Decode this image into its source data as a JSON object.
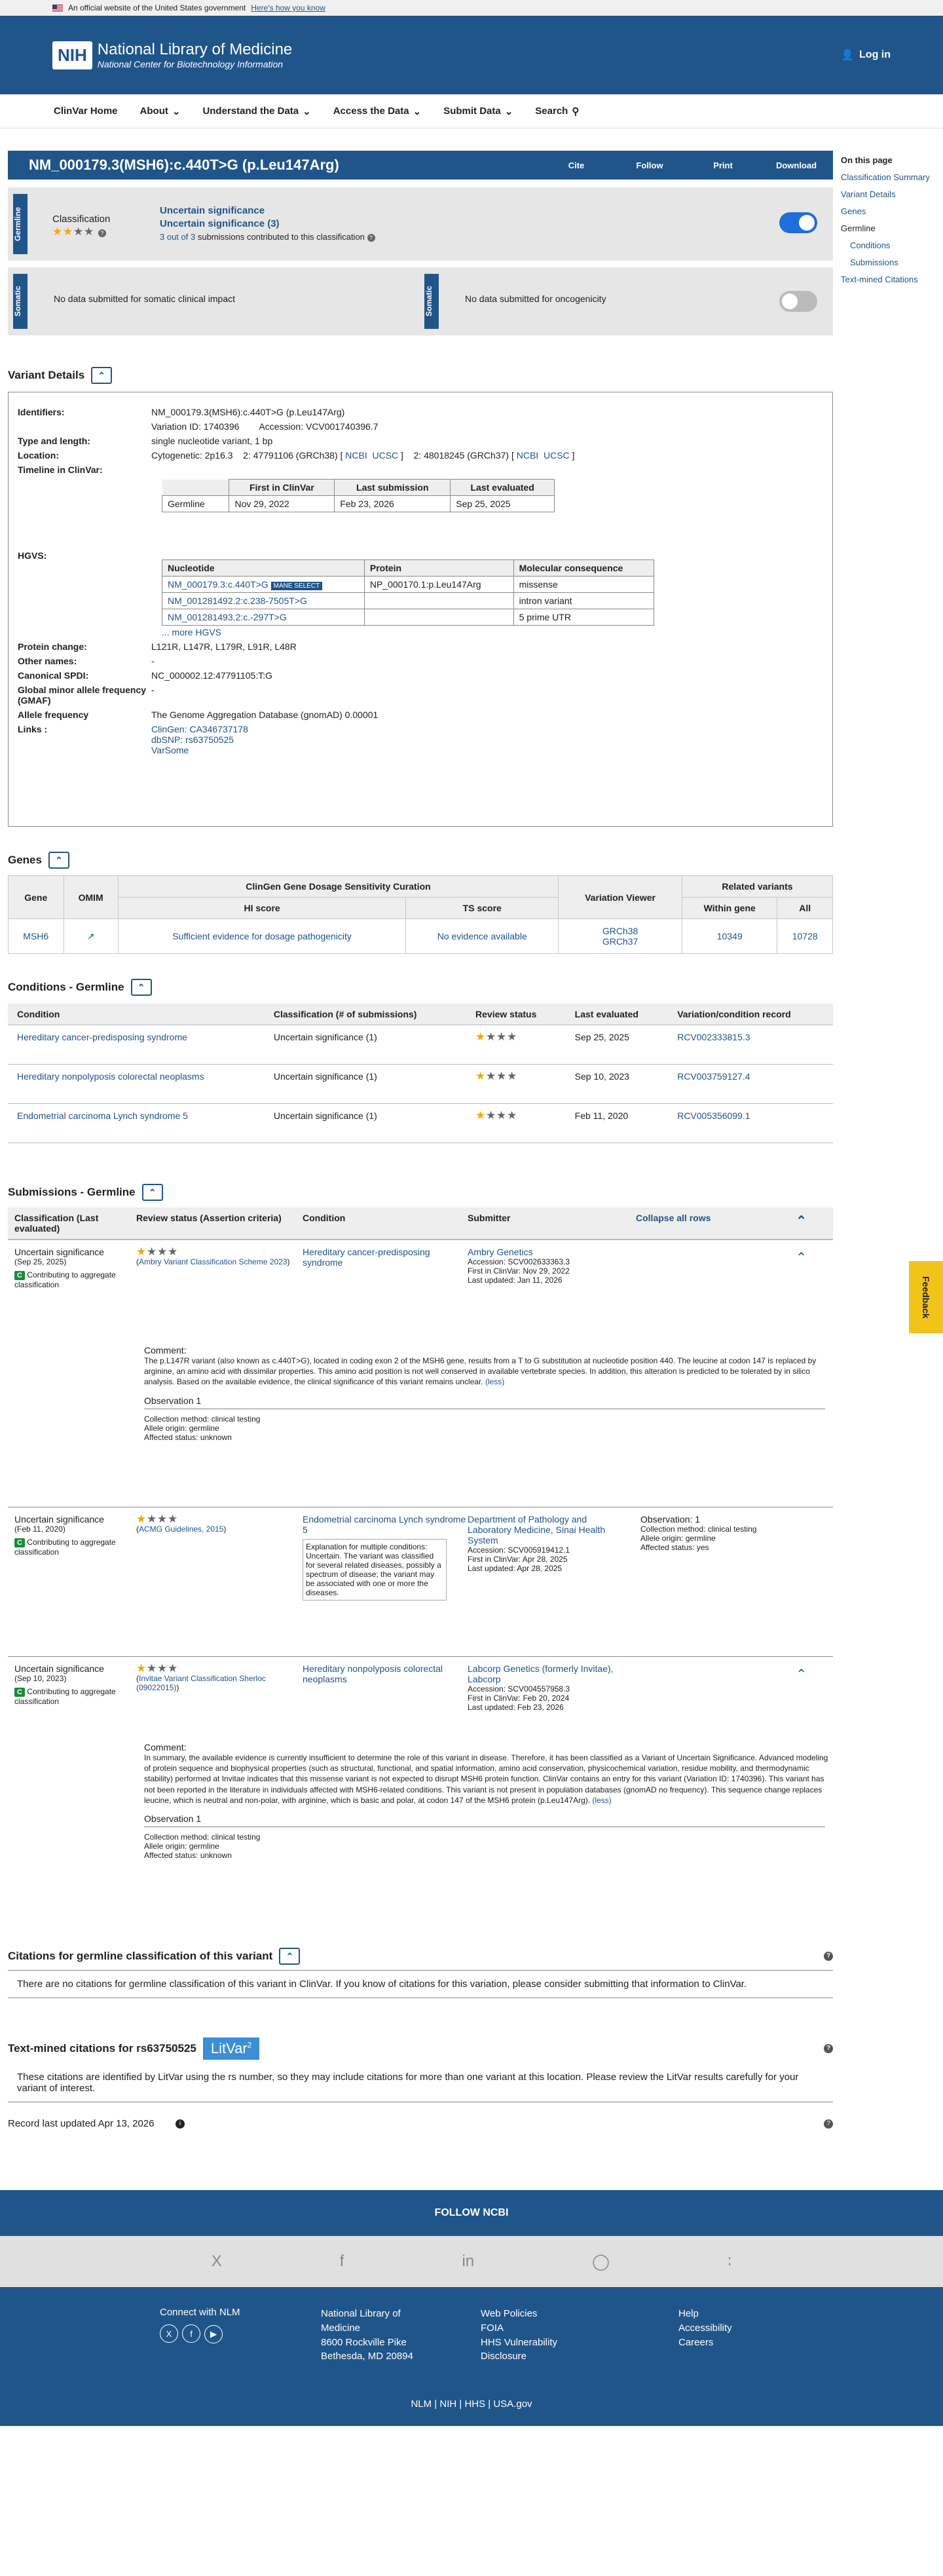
{
  "govbar": {
    "text": "An official website of the United States government",
    "how": "Here's how you know"
  },
  "header": {
    "logo": "NIH",
    "title": "National Library of Medicine",
    "subtitle": "National Center for Biotechnology Information",
    "login": "Log in"
  },
  "nav": {
    "items": [
      "ClinVar Home",
      "About",
      "Understand the Data",
      "Access the Data",
      "Submit Data",
      "Search"
    ]
  },
  "sidebar": {
    "title": "On this page",
    "items": [
      "Classification Summary",
      "Variant Details",
      "Genes",
      "Germline",
      "Conditions",
      "Submissions",
      "Text-mined Citations"
    ]
  },
  "title": {
    "text": "NM_000179.3(MSH6):c.440T>G (p.Leu147Arg)",
    "actions": [
      "Cite",
      "Follow",
      "Print",
      "Download"
    ]
  },
  "germline": {
    "label": "Germline",
    "classification_label": "Classification",
    "stars_filled": 1,
    "stars_total": 4,
    "line1": "Uncertain significance",
    "line2": "Uncertain significance (3)",
    "subs_link": "3 out of 3",
    "subs_rest": "submissions contributed to this classification"
  },
  "somatic": {
    "label": "Somatic",
    "left_text": "No data submitted for somatic clinical impact",
    "right_text": "No data submitted for oncogenicity"
  },
  "variant_details": {
    "title": "Variant Details",
    "identifiers_label": "Identifiers:",
    "identifiers": "NM_000179.3(MSH6):c.440T>G (p.Leu147Arg)",
    "variation_id": "Variation ID: 1740396",
    "accession": "Accession: VCV001740396.7",
    "type_label": "Type and length:",
    "type": "single nucleotide variant, 1 bp",
    "location_label": "Location:",
    "cyto": "Cytogenetic: 2p16.3",
    "loc38": "2: 47791106 (GRCh38)",
    "loc37": "2: 48018245 (GRCh37)",
    "ncbi": "NCBI",
    "ucsc": "UCSC",
    "timeline_label": "Timeline in ClinVar:",
    "timeline_headers": [
      "First in ClinVar",
      "Last submission",
      "Last evaluated"
    ],
    "timeline_row": [
      "Germline",
      "Nov 29, 2022",
      "Feb 23, 2026",
      "Sep 25, 2025"
    ],
    "hgvs_label": "HGVS:",
    "hgvs_headers": [
      "Nucleotide",
      "Protein",
      "Molecular consequence"
    ],
    "hgvs_rows": [
      {
        "nuc": "NM_000179.3:c.440T>G",
        "mane": "MANE SELECT",
        "protein": "NP_000170.1:p.Leu147Arg",
        "cons": "missense"
      },
      {
        "nuc": "NM_001281492.2:c.238-7505T>G",
        "protein": "",
        "cons": "intron variant"
      },
      {
        "nuc": "NM_001281493.2:c.-297T>G",
        "protein": "",
        "cons": "5 prime UTR"
      }
    ],
    "more_hgvs": "... more HGVS",
    "protein_change_label": "Protein change:",
    "protein_change": "L121R, L147R, L179R, L91R, L48R",
    "other_names_label": "Other names:",
    "other_names": "-",
    "spdi_label": "Canonical SPDI:",
    "spdi": "NC_000002.12:47791105:T:G",
    "gmaf_label": "Global minor allele frequency (GMAF)",
    "gmaf": "-",
    "af_label": "Allele frequency",
    "af": "The Genome Aggregation Database (gnomAD) 0.00001",
    "links_label": "Links :",
    "links": [
      "ClinGen: CA346737178",
      "dbSNP: rs63750525",
      "VarSome"
    ]
  },
  "genes": {
    "title": "Genes",
    "group_header": "ClinGen Gene Dosage Sensitivity Curation",
    "related_header": "Related variants",
    "headers": [
      "Gene",
      "OMIM",
      "HI score",
      "TS score",
      "Variation Viewer",
      "Within gene",
      "All"
    ],
    "row": {
      "gene": "MSH6",
      "hi": "Sufficient evidence for dosage pathogenicity",
      "ts": "No evidence available",
      "viewer1": "GRCh38",
      "viewer2": "GRCh37",
      "within": "10349",
      "all": "10728"
    }
  },
  "conditions": {
    "title": "Conditions - Germline",
    "headers": [
      "Condition",
      "Classification (# of submissions)",
      "Review status",
      "Last evaluated",
      "Variation/condition record"
    ],
    "rows": [
      {
        "cond": "Hereditary cancer-predisposing syndrome",
        "cls": "Uncertain significance (1)",
        "date": "Sep 25, 2025",
        "rec": "RCV002333815.3"
      },
      {
        "cond": "Hereditary nonpolyposis colorectal neoplasms",
        "cls": "Uncertain significance (1)",
        "date": "Sep 10, 2023",
        "rec": "RCV003759127.4"
      },
      {
        "cond": "Endometrial carcinoma Lynch syndrome 5",
        "cls": "Uncertain significance (1)",
        "date": "Feb 11, 2020",
        "rec": "RCV005356099.1"
      }
    ]
  },
  "submissions": {
    "title": "Submissions - Germline",
    "headers": [
      "Classification (Last evaluated)",
      "Review status (Assertion criteria)",
      "Condition",
      "Submitter"
    ],
    "collapse": "Collapse all rows",
    "contrib": "Contributing to aggregate classification",
    "rows": [
      {
        "cls": "Uncertain significance",
        "date": "(Sep 25, 2025)",
        "criteria": "Ambry Variant Classification Scheme 2023",
        "cond": "Hereditary cancer-predisposing syndrome",
        "submitter": "Ambry Genetics",
        "acc": "Accession: SCV002633363.3",
        "first": "First in ClinVar: Nov 29, 2022",
        "updated": "Last updated: Jan 11, 2026",
        "comment_label": "Comment:",
        "comment": "The p.L147R variant (also known as c.440T>G), located in coding exon 2 of the MSH6 gene, results from a T to G substitution at nucleotide position 440. The leucine at codon 147 is replaced by arginine, an amino acid with dissimilar properties. This amino acid position is not well conserved in available vertebrate species. In addition, this alteration is predicted to be tolerated by in silico analysis. Based on the available evidence, the clinical significance of this variant remains unclear.",
        "less": "(less)",
        "obs": "Observation 1",
        "method": "Collection method: clinical testing",
        "origin": "Allele origin: germline",
        "status": "Affected status: unknown"
      },
      {
        "cls": "Uncertain significance",
        "date": "(Feb 11, 2020)",
        "criteria": "ACMG Guidelines, 2015",
        "cond": "Endometrial carcinoma Lynch syndrome 5",
        "expl": "Explanation for multiple conditions: Uncertain. The variant was classified for several related diseases, possibly a spectrum of disease; the variant may be associated with one or more the diseases.",
        "submitter": "Department of Pathology and Laboratory Medicine, Sinai Health System",
        "acc": "Accession: SCV005919412.1",
        "first": "First in ClinVar: Apr 28, 2025",
        "updated": "Last updated: Apr 28, 2025",
        "obs": "Observation: 1",
        "method": "Collection method: clinical testing",
        "origin": "Allele origin: germline",
        "status": "Affected status: yes"
      },
      {
        "cls": "Uncertain significance",
        "date": "(Sep 10, 2023)",
        "criteria": "Invitae Variant Classification Sherloc (09022015)",
        "cond": "Hereditary nonpolyposis colorectal neoplasms",
        "submitter": "Labcorp Genetics (formerly Invitae), Labcorp",
        "acc": "Accession: SCV004557958.3",
        "first": "First in ClinVar: Feb 20, 2024",
        "updated": "Last updated: Feb 23, 2026",
        "comment_label": "Comment:",
        "comment": "In summary, the available evidence is currently insufficient to determine the role of this variant in disease. Therefore, it has been classified as a Variant of Uncertain Significance. Advanced modeling of protein sequence and biophysical properties (such as structural, functional, and spatial information, amino acid conservation, physicochemical variation, residue mobility, and thermodynamic stability) performed at Invitae indicates that this missense variant is not expected to disrupt MSH6 protein function. ClinVar contains an entry for this variant (Variation ID: 1740396). This variant has not been reported in the literature in individuals affected with MSH6-related conditions. This variant is not present in population databases (gnomAD no frequency). This sequence change replaces leucine, which is neutral and non-polar, with arginine, which is basic and polar, at codon 147 of the MSH6 protein (p.Leu147Arg).",
        "less": "(less)",
        "obs": "Observation 1",
        "method": "Collection method: clinical testing",
        "origin": "Allele origin: germline",
        "status": "Affected status: unknown"
      }
    ]
  },
  "citations": {
    "title": "Citations for germline classification of this variant",
    "text": "There are no citations for germline classification of this variant in ClinVar. If you know of citations for this variation, please consider submitting that information to ClinVar."
  },
  "textmined": {
    "title": "Text-mined citations for rs63750525",
    "litvar": "LitVar",
    "litvar_sup": "2",
    "text": "These citations are identified by LitVar using the rs number, so they may include citations for more than one variant at this location. Please review the LitVar results carefully for your variant of interest."
  },
  "record": "Record last updated Apr 13, 2026",
  "feedback": "Feedback",
  "footer": {
    "follow": "FOLLOW NCBI",
    "social": [
      "X",
      "f",
      "in",
      "GitHub",
      "RSS"
    ],
    "connect": "Connect with NLM",
    "nlm": [
      "National Library of Medicine",
      "8600 Rockville Pike",
      "Bethesda, MD 20894"
    ],
    "col3": [
      "Web Policies",
      "FOIA",
      "HHS Vulnerability Disclosure"
    ],
    "col4": [
      "Help",
      "Accessibility",
      "Careers"
    ],
    "bottom": [
      "NLM",
      "NIH",
      "HHS",
      "USA.gov"
    ]
  },
  "colors": {
    "primary": "#20558a",
    "star": "#f0a800",
    "green": "#1a8a3b",
    "feedback": "#f0c419"
  }
}
